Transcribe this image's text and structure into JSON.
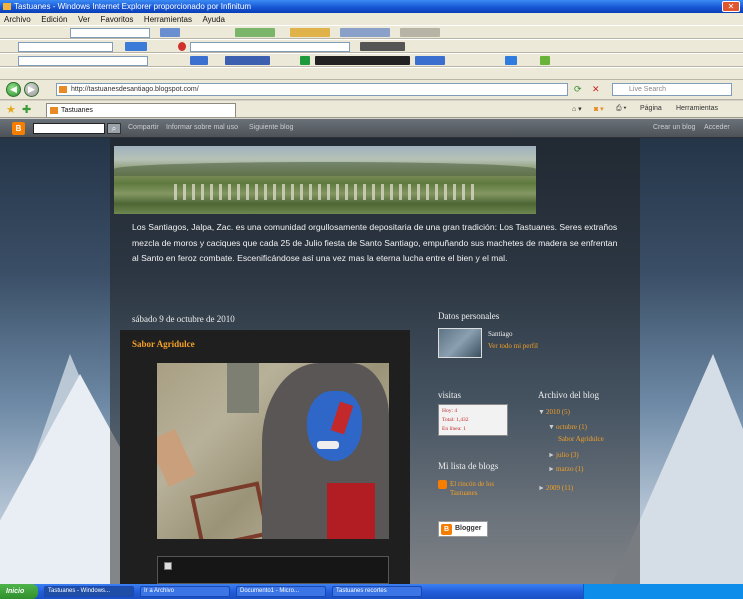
{
  "window": {
    "title": "Tastuanes - Windows Internet Explorer proporcionado por Infinitum"
  },
  "menu": [
    "Archivo",
    "Edición",
    "Ver",
    "Favoritos",
    "Herramientas",
    "Ayuda"
  ],
  "address": {
    "url": "http://tastuanesdesantiago.blogspot.com/",
    "search_placeholder": "Live Search"
  },
  "tab": {
    "label": "Tastuanes"
  },
  "commands": {
    "inicio": "Página",
    "tools": "Herramientas"
  },
  "blogger_nav": {
    "links": [
      "Compartir",
      "Informar sobre mal uso",
      "Siguiente blog"
    ],
    "right_links": [
      "Crear un blog",
      "Acceder"
    ]
  },
  "blog": {
    "description": "Los Santiagos, Jalpa, Zac. es una comunidad orgullosamente depositaria de una gran tradición: Los Tastuanes. Seres extraños mezcla de moros y caciques que cada 25 de Julio fiesta de Santo Santiago, empuñando sus machetes de madera se enfrentan al Santo en feroz combate. Escenificándose así una vez mas la eterna lucha entre el bien y el mal.",
    "post_date": "sábado 9 de octubre de 2010",
    "post_title": "Sabor Agridulce"
  },
  "sidebar": {
    "profile_heading": "Datos personales",
    "profile_name": "Santiago",
    "profile_link": "Ver todo mi perfil",
    "visits_heading": "visitas",
    "visitor_rows": [
      "Hoy: 4",
      "Total: 1,432",
      "En línea: 1"
    ],
    "archive_heading": "Archivo del blog",
    "archive": [
      {
        "label": "2010 (5)",
        "level": 0
      },
      {
        "label": "octubre (1)",
        "level": 1
      },
      {
        "label": "Sabor Agridulce",
        "level": 2
      },
      {
        "label": "julio (3)",
        "level": 1
      },
      {
        "label": "marzo (1)",
        "level": 1
      },
      {
        "label": "2009 (11)",
        "level": 0
      }
    ],
    "bloglist_heading": "Mi lista de blogs",
    "bloglist_items": [
      "El rincón de los Tastuanes",
      "Tastuanes"
    ],
    "badge": "Blogger"
  },
  "taskbar": {
    "start": "Inicio",
    "tasks": [
      "Tastuanes - Windows...",
      "Ir a Archivo",
      "Documento1 - Micro...",
      "Tastuanes recortes"
    ]
  },
  "colors": {
    "accent": "#f3a025",
    "xp_blue": "#245edb"
  }
}
